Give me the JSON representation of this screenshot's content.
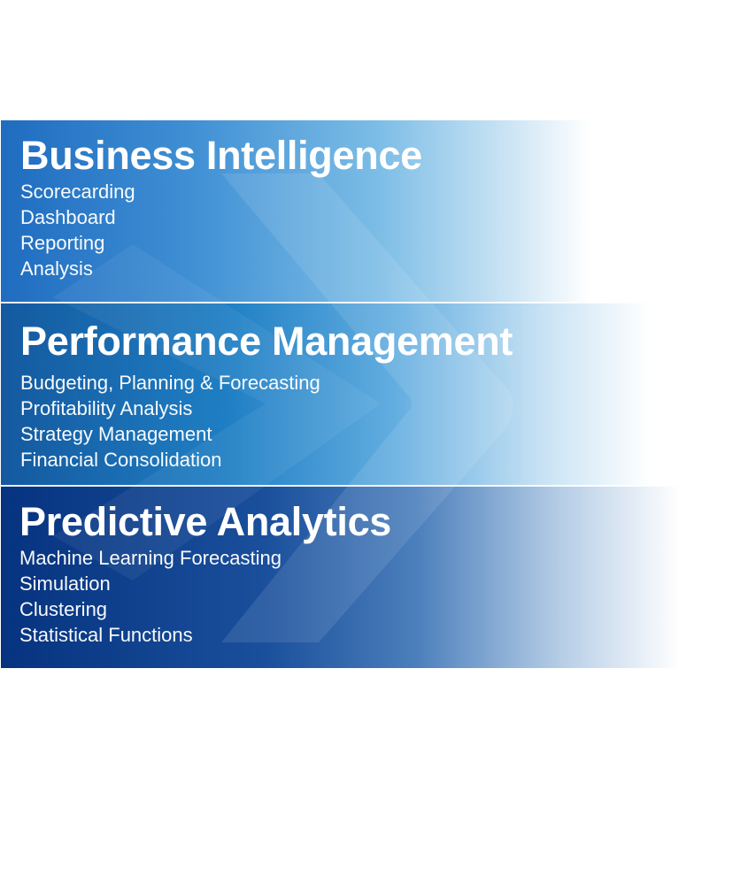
{
  "sections": [
    {
      "title": "Business Intelligence",
      "items": [
        "Scorecarding",
        "Dashboard",
        "Reporting",
        "Analysis"
      ]
    },
    {
      "title": "Performance Management",
      "items": [
        "Budgeting, Planning & Forecasting",
        "Profitability Analysis",
        "Strategy Management",
        "Financial Consolidation"
      ]
    },
    {
      "title": "Predictive Analytics",
      "items": [
        "Machine Learning Forecasting",
        "Simulation",
        "Clustering",
        "Statistical Functions"
      ]
    }
  ],
  "colors": {
    "dark_blue": "#06337f",
    "mid_blue": "#1f6cc0",
    "light_blue": "#7cbde6",
    "text": "#ffffff"
  }
}
